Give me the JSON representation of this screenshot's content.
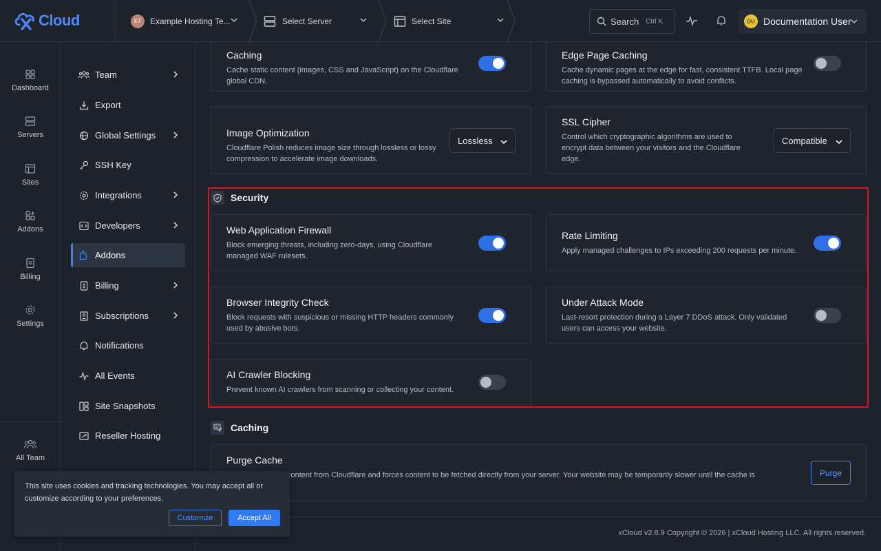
{
  "brand": {
    "logo_text": "Cloud"
  },
  "topbar": {
    "team": {
      "initials": "ET",
      "label": "Example Hosting Te..."
    },
    "server": {
      "label": "Select Server"
    },
    "site": {
      "label": "Select Site"
    },
    "search": {
      "label": "Search",
      "shortcut": "Ctrl K"
    },
    "user": {
      "initials": "DU",
      "name": "Documentation User"
    }
  },
  "rail": {
    "items": [
      {
        "label": "Dashboard",
        "icon": "dashboard-icon"
      },
      {
        "label": "Servers",
        "icon": "server-icon"
      },
      {
        "label": "Sites",
        "icon": "sites-icon"
      },
      {
        "label": "Addons",
        "icon": "addons-icon"
      },
      {
        "label": "Billing",
        "icon": "billing-icon"
      },
      {
        "label": "Settings",
        "icon": "gear-icon"
      }
    ],
    "bottom": {
      "label": "All Team",
      "icon": "team-icon"
    }
  },
  "sidebar": {
    "items": [
      {
        "label": "Team",
        "icon": "team-icon",
        "has_arrow": true
      },
      {
        "label": "Export",
        "icon": "export-icon",
        "has_arrow": false
      },
      {
        "label": "Global Settings",
        "icon": "globe-gear-icon",
        "has_arrow": true
      },
      {
        "label": "SSH Key",
        "icon": "key-icon",
        "has_arrow": false
      },
      {
        "label": "Integrations",
        "icon": "integrations-icon",
        "has_arrow": true
      },
      {
        "label": "Developers",
        "icon": "code-icon",
        "has_arrow": true
      },
      {
        "label": "Addons",
        "icon": "addons-icon",
        "has_arrow": false,
        "active": true
      },
      {
        "label": "Billing",
        "icon": "billing-icon",
        "has_arrow": true
      },
      {
        "label": "Subscriptions",
        "icon": "subscriptions-icon",
        "has_arrow": true
      },
      {
        "label": "Notifications",
        "icon": "bell-icon",
        "has_arrow": false
      },
      {
        "label": "All Events",
        "icon": "activity-icon",
        "has_arrow": false
      },
      {
        "label": "Site Snapshots",
        "icon": "snapshot-icon",
        "has_arrow": false
      },
      {
        "label": "Reseller Hosting",
        "icon": "reseller-icon",
        "has_arrow": false
      }
    ]
  },
  "performance": {
    "caching": {
      "title": "Caching",
      "desc": "Cache static content (images, CSS and JavaScript) on the Cloudflare global CDN.",
      "enabled": true
    },
    "edge_caching": {
      "title": "Edge Page Caching",
      "desc": "Cache dynamic pages at the edge for fast, consistent TTFB. Local page caching is bypassed automatically to avoid conflicts.",
      "enabled": false
    },
    "image_opt": {
      "title": "Image Optimization",
      "desc": "Cloudflare Polish reduces image size through lossless or lossy compression to accelerate image downloads.",
      "value": "Lossless"
    },
    "ssl_cipher": {
      "title": "SSL Cipher",
      "desc": "Control which cryptographic algorithms are used to encrypt data between your visitors and the Cloudflare edge.",
      "value": "Compatible"
    }
  },
  "security": {
    "heading": "Security",
    "waf": {
      "title": "Web Application Firewall",
      "desc": "Block emerging threats, including zero-days, using Cloudflare managed WAF rulesets.",
      "enabled": true
    },
    "rate_limiting": {
      "title": "Rate Limiting",
      "desc": "Apply managed challenges to IPs exceeding 200 requests per minute.",
      "enabled": true
    },
    "bic": {
      "title": "Browser Integrity Check",
      "desc": "Block requests with suspicious or missing HTTP headers commonly used by abusive bots.",
      "enabled": true
    },
    "under_attack": {
      "title": "Under Attack Mode",
      "desc": "Last-resort protection during a Layer 7 DDoS attack. Only validated users can access your website.",
      "enabled": false
    },
    "ai_crawler": {
      "title": "AI Crawler Blocking",
      "desc": "Prevent known AI crawlers from scanning or collecting your content.",
      "enabled": false
    }
  },
  "caching_section": {
    "heading": "Caching",
    "purge": {
      "title": "Purge Cache",
      "desc": "content from Cloudflare and forces content to be fetched directly from your server. Your website may be temporarily slower until the cache is",
      "button": "Purge"
    }
  },
  "footer": {
    "copyright": "xCloud v2.8.9 Copyright © 2026 | xCloud Hosting LLC. All rights reserved."
  },
  "cookie": {
    "text": "This site uses cookies and tracking technologies. You may accept all or customize according to your preferences.",
    "customize": "Customize",
    "accept": "Accept All"
  },
  "colors": {
    "accent": "#2f6fe8",
    "highlight": "#e0121e",
    "background": "#1d222b"
  }
}
